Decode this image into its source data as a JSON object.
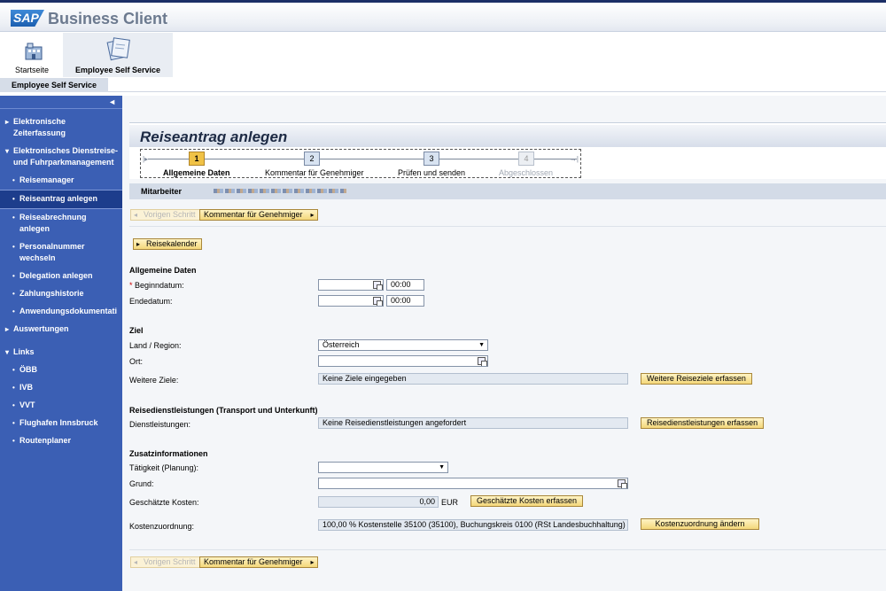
{
  "header": {
    "brand": "SAP",
    "app_title": "Business Client"
  },
  "launchpad": {
    "home_label": "Startseite",
    "ess_label": "Employee Self Service"
  },
  "breadcrumb": {
    "tab_label": "Employee Self Service"
  },
  "sidebar": {
    "collapse_glyph": "◄",
    "items": [
      {
        "label": "Elektronische Zeiterfassung",
        "mark": "▸"
      },
      {
        "label": "Elektronisches Dienstreise- und Fuhrparkmanagement",
        "mark": "▾"
      },
      {
        "label": "Reisemanager",
        "mark": "•"
      },
      {
        "label": "Reiseantrag anlegen",
        "mark": "•"
      },
      {
        "label": "Reiseabrechnung anlegen",
        "mark": "•"
      },
      {
        "label": "Personalnummer wechseln",
        "mark": "•"
      },
      {
        "label": "Delegation anlegen",
        "mark": "•"
      },
      {
        "label": "Zahlungshistorie",
        "mark": "•"
      },
      {
        "label": "Anwendungsdokumentati",
        "mark": "•"
      },
      {
        "label": "Auswertungen",
        "mark": "▸"
      },
      {
        "label": "Links",
        "mark": "▾"
      },
      {
        "label": "ÖBB",
        "mark": "•"
      },
      {
        "label": "IVB",
        "mark": "•"
      },
      {
        "label": "VVT",
        "mark": "•"
      },
      {
        "label": "Flughafen Innsbruck",
        "mark": "•"
      },
      {
        "label": "Routenplaner",
        "mark": "•"
      }
    ]
  },
  "page": {
    "title": "Reiseantrag anlegen",
    "employee_label": "Mitarbeiter"
  },
  "roadmap": {
    "steps": [
      {
        "number": "1",
        "label": "Allgemeine Daten"
      },
      {
        "number": "2",
        "label": "Kommentar für Genehmiger"
      },
      {
        "number": "3",
        "label": "Prüfen und senden"
      },
      {
        "number": "4",
        "label": "Abgeschlossen"
      }
    ],
    "current_step": 1
  },
  "nav": {
    "prev_label": "Vorigen Schritt",
    "next_label": "Kommentar für Genehmiger",
    "calendar_label": "Reisekalender"
  },
  "general": {
    "heading": "Allgemeine Daten",
    "required_mark": "*",
    "begin_label": "Beginndatum:",
    "begin_date": "",
    "begin_time": "00:00",
    "end_label": "Endedatum:",
    "end_date": "",
    "end_time": "00:00"
  },
  "destination": {
    "heading": "Ziel",
    "country_label": "Land / Region:",
    "country_value": "Österreich",
    "place_label": "Ort:",
    "place_value": "",
    "more_label": "Weitere Ziele:",
    "more_value": "Keine Ziele eingegeben",
    "more_button": "Weitere Reiseziele erfassen"
  },
  "services": {
    "heading": "Reisedienstleistungen (Transport und Unterkunft)",
    "label": "Dienstleistungen:",
    "value": "Keine Reisedienstleistungen angefordert",
    "button": "Reisedienstleistungen erfassen"
  },
  "additional": {
    "heading": "Zusatzinformationen",
    "activity_label": "Tätigkeit (Planung):",
    "activity_value": "",
    "reason_label": "Grund:",
    "reason_value": "",
    "cost_label": "Geschätzte Kosten:",
    "cost_value": "0,00",
    "cost_currency": "EUR",
    "cost_button": "Geschätzte Kosten erfassen",
    "assign_label": "Kostenzuordnung:",
    "assign_value": "100,00 % Kostenstelle 35100 (35100), Buchungskreis 0100 (RSt Landesbuchhaltung)",
    "assign_button": "Kostenzuordnung ändern"
  },
  "colors": {
    "sidebar": "#3b5fb4",
    "sidebar_active": "#1d3d8c",
    "button": "#f4d77a",
    "step_current": "#f0c246"
  },
  "icons": {
    "home": "building-icon",
    "ess": "documents-icon",
    "calendar": "calendar-icon",
    "value_help": "value-help-icon",
    "dropdown": "chevron-down-icon"
  }
}
